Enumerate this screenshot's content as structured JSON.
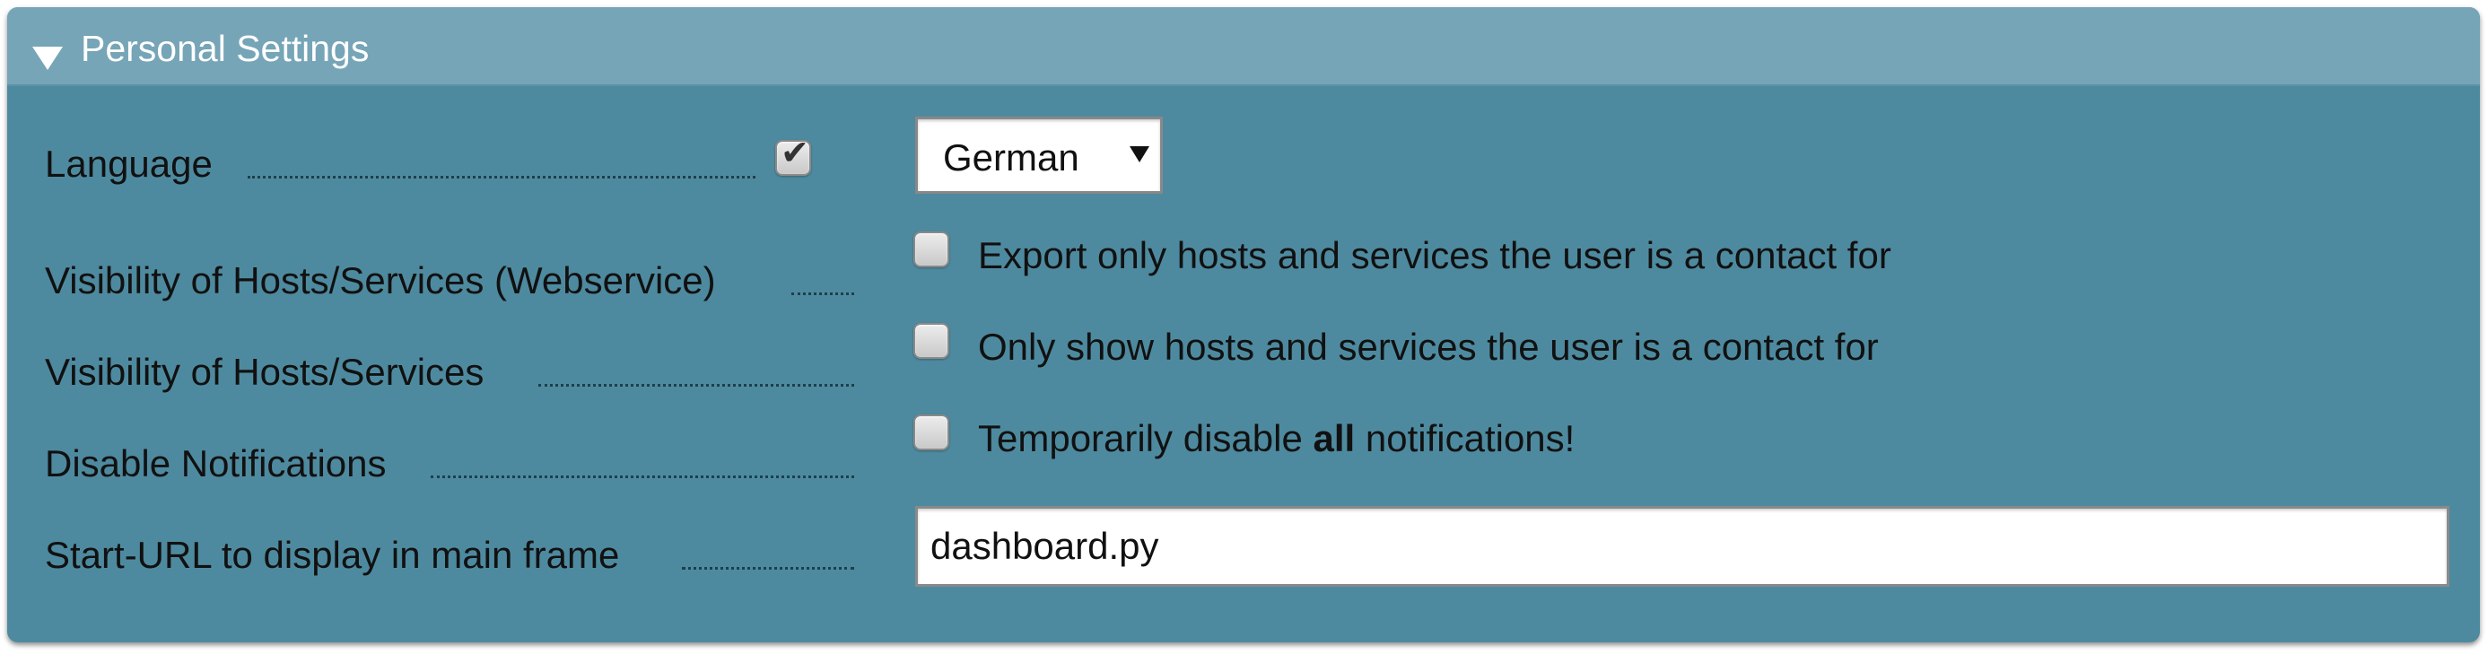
{
  "panel": {
    "title": "Personal Settings",
    "background_color": "#4e8a9f",
    "header_color": "#76a5b7",
    "icon": "triangle-down-icon"
  },
  "language": {
    "label": "Language",
    "override_checked": true,
    "selected_value": "German"
  },
  "visibility_webservice": {
    "label": "Visibility of Hosts/Services (Webservice)",
    "checked": false,
    "option_text": "Export only hosts and services the user is a contact for"
  },
  "visibility": {
    "label": "Visibility of Hosts/Services",
    "checked": false,
    "option_text": "Only show hosts and services the user is a contact for"
  },
  "notifications": {
    "label": "Disable Notifications",
    "checked": false,
    "option_text_before": "Temporarily disable ",
    "option_text_bold": "all",
    "option_text_after": " notifications!"
  },
  "start_url": {
    "label": "Start-URL to display in main frame",
    "value": "dashboard.py"
  }
}
